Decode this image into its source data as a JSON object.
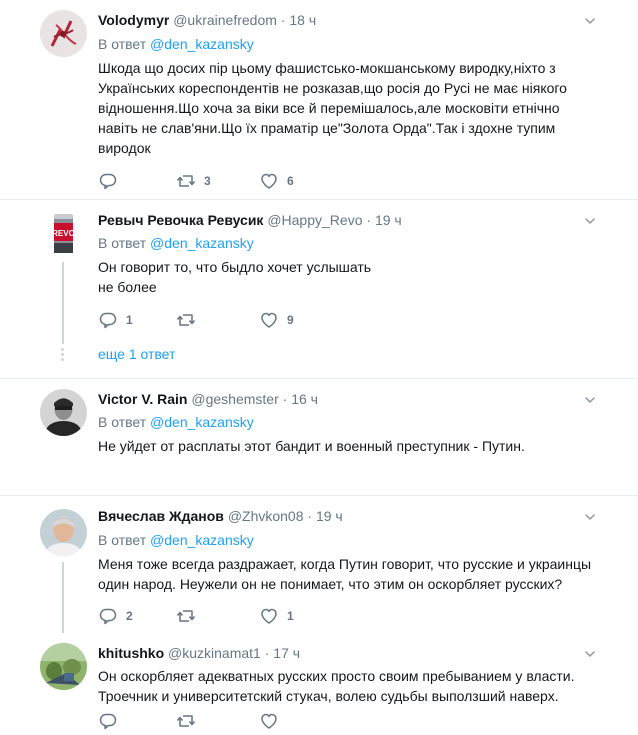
{
  "tweets": [
    {
      "name": "Volodymyr",
      "handle": "@ukrainefredom",
      "time": "18 ч",
      "reply_prefix": "В ответ",
      "reply_to": "@den_kazansky",
      "lines": [
        "Шкода що досих пір цьому фашистсько-мокшанському виродку,ніхто з",
        "Українських кореспондентів не розказав,що росія до Русі не має ніякого",
        "відношення.Що хоча за віки все й перемішалось,але московіти етнічно",
        "навіть не слав'яни.Що їх праматір це\"Золота Орда\".Так і здохне тупим",
        "виродок"
      ],
      "replies": "",
      "retweets": "3",
      "likes": "6"
    },
    {
      "name": "Ревыч Ревочка Ревусик",
      "handle": "@Happy_Revo",
      "time": "19 ч",
      "reply_prefix": "В ответ",
      "reply_to": "@den_kazansky",
      "lines": [
        "Он говорит то, что быдло хочет услышать",
        "не более"
      ],
      "replies": "1",
      "retweets": "",
      "likes": "9",
      "more_replies": "еще 1 ответ"
    },
    {
      "name": "Victor V. Rain",
      "handle": "@geshemster",
      "time": "16 ч",
      "reply_prefix": "В ответ",
      "reply_to": "@den_kazansky",
      "lines": [
        "Не уйдет от расплаты этот бандит и военный преступник - Путин."
      ]
    },
    {
      "name": "Вячеслав Жданов",
      "handle": "@Zhvkon08",
      "time": "19 ч",
      "reply_prefix": "В ответ",
      "reply_to": "@den_kazansky",
      "lines": [
        "Меня тоже всегда раздражает, когда Путин говорит, что русские и украинцы",
        "один народ. Неужели он не понимает, что этим он оскорбляет русских?"
      ],
      "replies": "2",
      "retweets": "",
      "likes": "1"
    },
    {
      "name": "khitushko",
      "handle": "@kuzkinamat1",
      "time": "17 ч",
      "lines": [
        "Он оскорбляет адекватных русских просто своим пребыванием у власти.",
        "Троечник и университетский стукач, волею судьбы выползший наверх."
      ],
      "replies": "",
      "retweets": "",
      "likes": ""
    }
  ],
  "icons": {
    "reply": "reply-icon",
    "retweet": "retweet-icon",
    "like": "heart-icon",
    "menu": "chevron-down-icon"
  },
  "colors": {
    "link": "#1da1f2",
    "secondary_text": "#657786",
    "divider": "#e6ecf0",
    "thread_line": "#ccd6dd"
  }
}
